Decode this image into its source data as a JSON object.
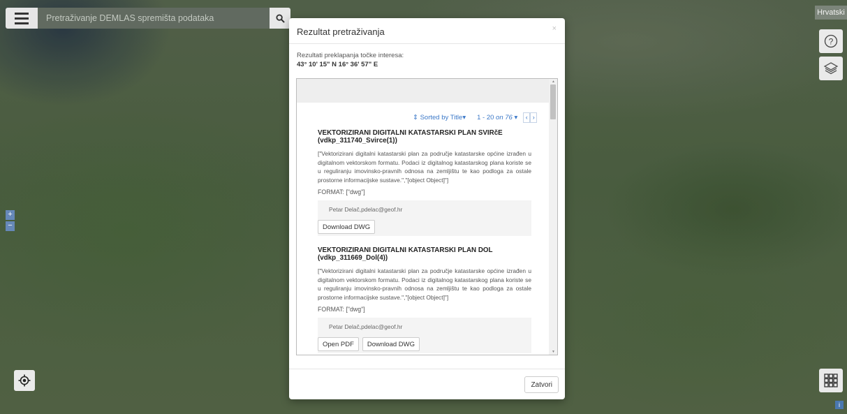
{
  "search": {
    "placeholder": "Pretraživanje DEMLAS spremišta podataka"
  },
  "language": "Hrvatski",
  "zoom": {
    "in": "+",
    "out": "−"
  },
  "modal": {
    "title": "Rezultat pretraživanja",
    "close_glyph": "×",
    "intro": "Rezultati preklapanja točke interesa:",
    "coordinates": "43° 10' 15\" N 16° 36' 57\" E",
    "pager": {
      "sort_label": "⇕ Sorted by Title▾",
      "range_prefix": "1 - 20",
      "range_of": "on",
      "range_total": "76",
      "range_caret": "▾",
      "prev": "‹",
      "next": "›"
    },
    "results": [
      {
        "title": "VEKTORIZIRANI DIGITALNI KATASTARSKI PLAN SVIRčE (vdkp_311740_Svirce(1))",
        "description": "[\"Vektorizirani digitalni katastarski plan za područje katastarske općine izrađen u digitalnom vektorskom formatu. Podaci iz digitalnog katastarskog plana koriste se u reguliranju imovinsko-pravnih odnosa na zemljištu te kao podloga za ostale prostorne informacijske sustave.\",\"[object Object]\"]",
        "format": "FORMAT: [\"dwg\"]",
        "contact": "Petar Delač,pdelac@geof.hr",
        "buttons": [
          "Download DWG"
        ]
      },
      {
        "title": "VEKTORIZIRANI DIGITALNI KATASTARSKI PLAN DOL (vdkp_311669_Dol(4))",
        "description": "[\"Vektorizirani digitalni katastarski plan za područje katastarske općine izrađen u digitalnom vektorskom formatu. Podaci iz digitalnog katastarskog plana koriste se u reguliranju imovinsko-pravnih odnosa na zemljištu te kao podloga za ostale prostorne informacijske sustave.\",\"[object Object]\"]",
        "format": "FORMAT: [\"dwg\"]",
        "contact": "Petar Delač,pdelac@geof.hr",
        "buttons": [
          "Open PDF",
          "Download DWG"
        ]
      }
    ],
    "close_button": "Zatvori"
  },
  "icons": {
    "menu": "hamburger-menu-icon",
    "search": "magnifier-icon",
    "help": "question-circle-icon",
    "layers": "layers-stack-icon",
    "locate": "crosshair-target-icon",
    "apps": "grid-apps-icon",
    "info": "info-icon"
  },
  "colors": {
    "accent": "#3b78c8",
    "zoom": "#6688b8",
    "search_bg": "#616a60"
  }
}
